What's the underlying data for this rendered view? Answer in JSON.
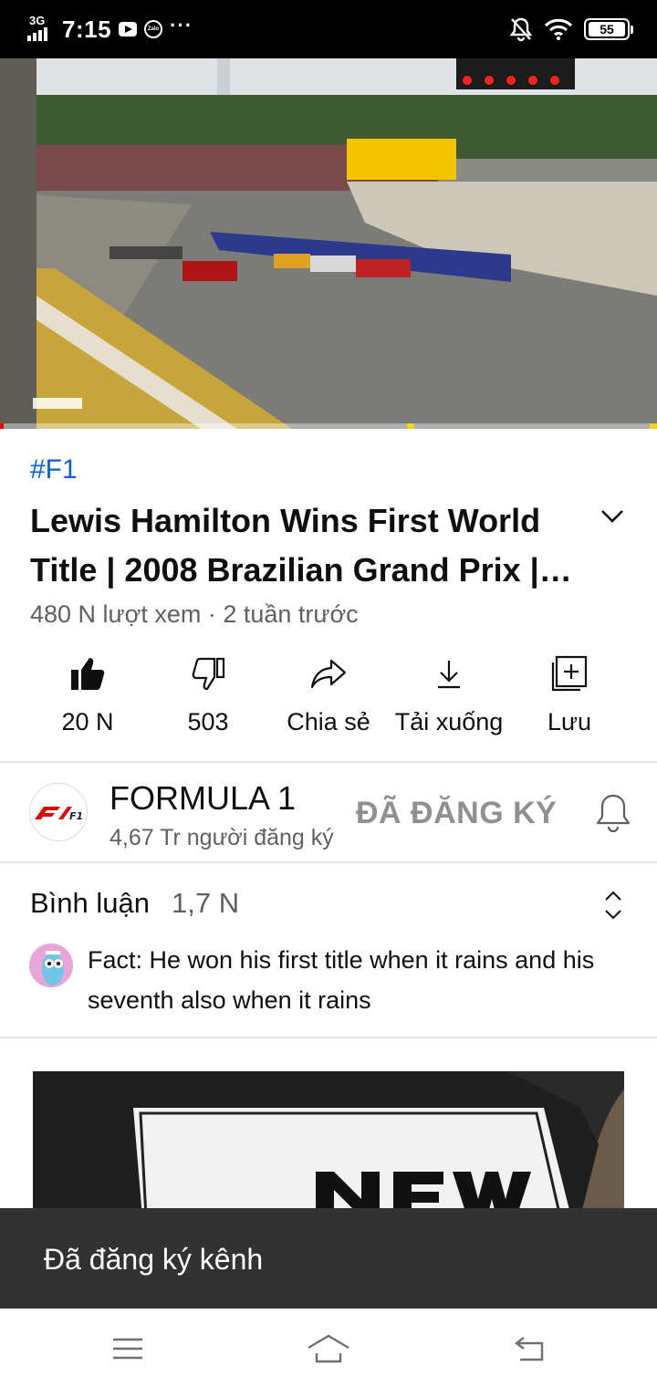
{
  "status_bar": {
    "network": "3G",
    "time": "7:15",
    "more": "···",
    "battery": "55",
    "zalo_badge": "Zalo"
  },
  "video": {
    "progress_fraction": 0.006,
    "chapter_marks_fraction": [
      0.62,
      0.995
    ]
  },
  "info": {
    "hashtag": "#F1",
    "title": "Lewis Hamilton Wins First World Title | 2008 Brazilian Grand Prix | …",
    "meta": "480 N lượt xem · 2 tuần trước"
  },
  "actions": {
    "like": "20 N",
    "dislike": "503",
    "share": "Chia sẻ",
    "download": "Tải xuống",
    "save": "Lưu"
  },
  "channel": {
    "name": "FORMULA 1",
    "subscribers": "4,67 Tr người đăng ký",
    "subscribe_state": "ĐÃ ĐĂNG KÝ",
    "logo_text": "F1 70"
  },
  "comments": {
    "label": "Bình luận",
    "count": "1,7 N",
    "top_comment": "Fact: He won his first title when it rains and his seventh also when it rains"
  },
  "snackbar": {
    "message": "Đã đăng ký kênh"
  },
  "colors": {
    "link_blue": "#065fd4",
    "progress_red": "#ff0000",
    "snackbar_bg": "#323232"
  }
}
